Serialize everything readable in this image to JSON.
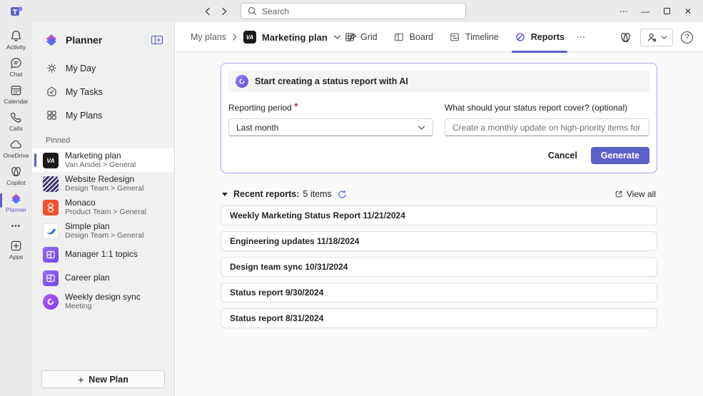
{
  "colors": {
    "accent": "#5b5fc7",
    "panel_border": "#b0a7e6"
  },
  "titlebar": {
    "search_placeholder": "Search",
    "more_glyph": "⋯",
    "minimize_glyph": "—",
    "close_glyph": "✕"
  },
  "rail": {
    "items": [
      {
        "label": "Activity"
      },
      {
        "label": "Chat"
      },
      {
        "label": "Calendar"
      },
      {
        "label": "Calls"
      },
      {
        "label": "OneDrive"
      },
      {
        "label": "Copilot"
      },
      {
        "label": "Planner"
      }
    ],
    "more_glyph": "•••",
    "apps_label": "Apps"
  },
  "sidebar": {
    "app_title": "Planner",
    "nav": [
      {
        "label": "My Day"
      },
      {
        "label": "My Tasks"
      },
      {
        "label": "My Plans"
      }
    ],
    "pinned_label": "Pinned",
    "plans": [
      {
        "title": "Marketing plan",
        "subtitle": "Van Arsdel > General",
        "badge": "VA"
      },
      {
        "title": "Website Redesign",
        "subtitle": "Design Team > General"
      },
      {
        "title": "Monaco",
        "subtitle": "Product Team > General"
      },
      {
        "title": "Simple plan",
        "subtitle": "Design Team > General"
      },
      {
        "title": "Manager 1:1 topics",
        "subtitle": ""
      },
      {
        "title": "Career plan",
        "subtitle": ""
      },
      {
        "title": "Weekly design sync",
        "subtitle": "Meeting"
      }
    ],
    "new_plan": {
      "icon": "+",
      "label": "New Plan"
    }
  },
  "header": {
    "breadcrumb_root": "My plans",
    "separator": ">",
    "plan_badge": "VA",
    "plan_title": "Marketing plan",
    "tabs": [
      {
        "label": "Grid"
      },
      {
        "label": "Board"
      },
      {
        "label": "Timeline"
      },
      {
        "label": "Reports",
        "active": true
      }
    ],
    "more_tabs_glyph": "⋯",
    "help_glyph": "?"
  },
  "ai_panel": {
    "title": "Start creating a status report with AI",
    "period_label": "Reporting period",
    "required_mark": "*",
    "period_value": "Last month",
    "cover_label": "What should your status report cover? (optional)",
    "cover_placeholder": "Create a monthly update on high-priority items for the team",
    "cancel_label": "Cancel",
    "generate_label": "Generate"
  },
  "recent": {
    "title": "Recent reports:",
    "count": "5 items",
    "view_all_label": "View all",
    "reports": [
      {
        "title": "Weekly Marketing Status Report 11/21/2024"
      },
      {
        "title": "Engineering updates 11/18/2024"
      },
      {
        "title": "Design team sync 10/31/2024"
      },
      {
        "title": "Status report 9/30/2024"
      },
      {
        "title": "Status report 8/31/2024"
      }
    ]
  }
}
